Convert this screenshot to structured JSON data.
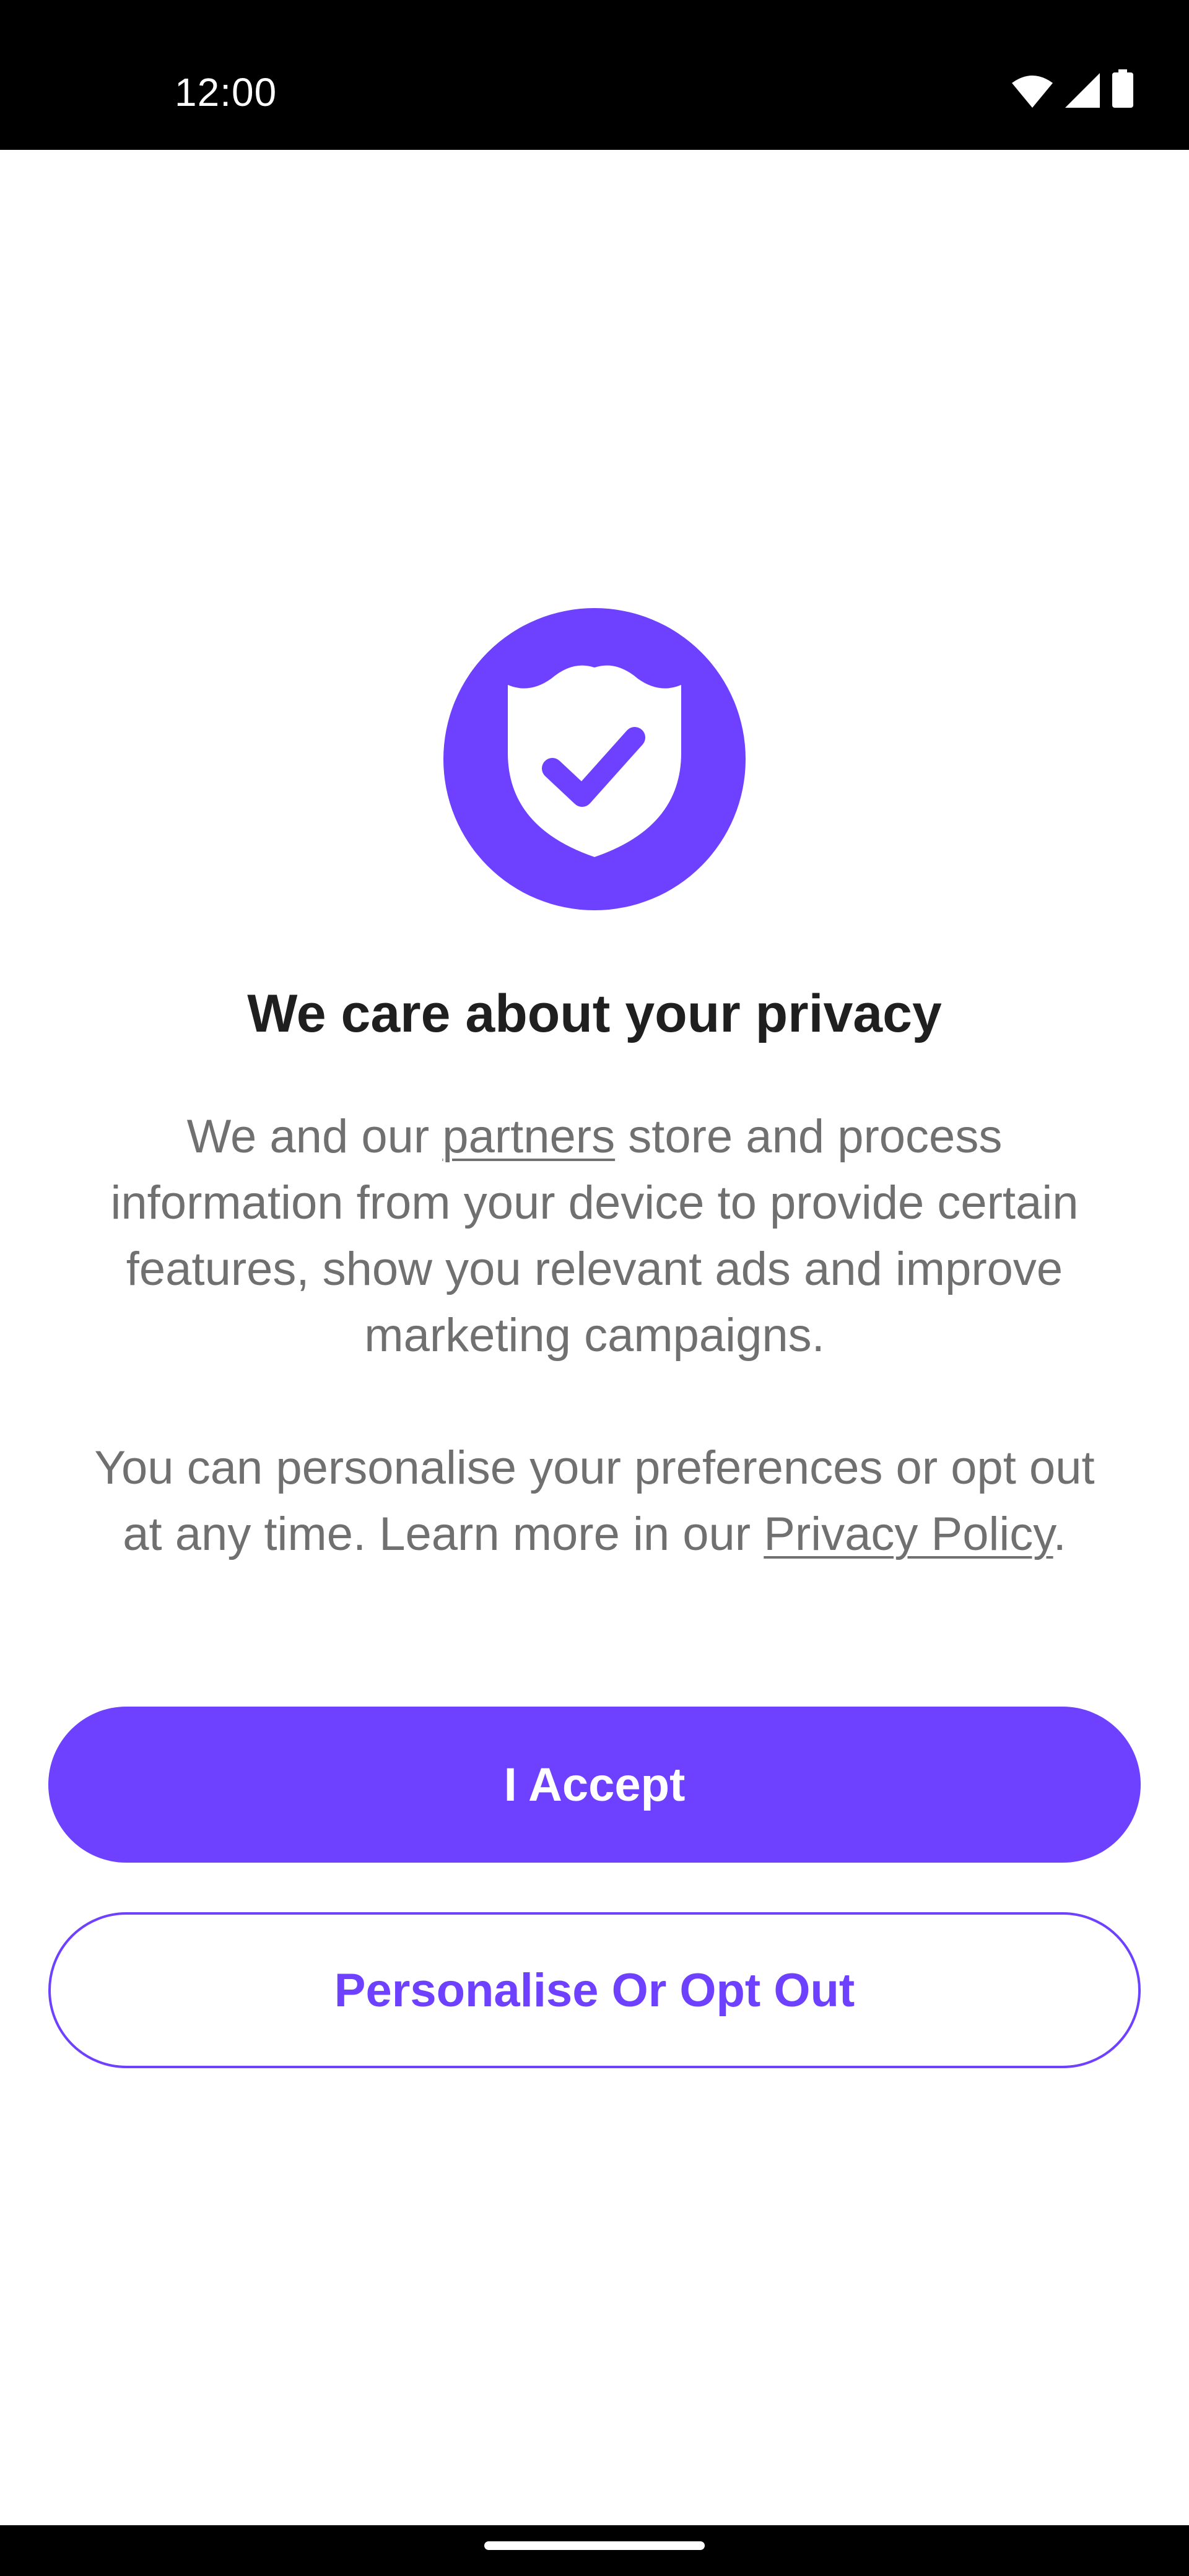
{
  "status_bar": {
    "time": "12:00",
    "icons": [
      "wifi-icon",
      "cellular-signal-icon",
      "battery-icon"
    ]
  },
  "consent": {
    "icon": "shield-check-icon",
    "title": "We care about your privacy",
    "paragraph1": {
      "before_link": "We and our ",
      "link_text": "partners",
      "after_link": " store and process information from your device to provide certain features, show you relevant ads and improve marketing campaigns."
    },
    "paragraph2": {
      "before_link": "You can personalise your preferences or opt out at any time. Learn more in our ",
      "link_text": "Privacy Policy",
      "after_link": "."
    },
    "accept_label": "I Accept",
    "personalise_label": "Personalise Or Opt Out"
  },
  "colors": {
    "accent": "#6e40ff",
    "title": "#1f1f1f",
    "body": "#707070",
    "system_bar": "#000000"
  }
}
